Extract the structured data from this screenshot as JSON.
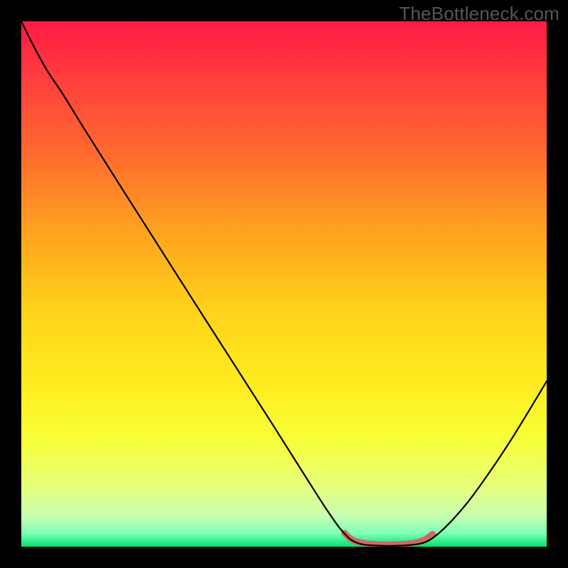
{
  "watermark": "TheBottleneck.com",
  "chart_data": {
    "type": "line",
    "title": "",
    "xlabel": "",
    "ylabel": "",
    "xlim": [
      0,
      100
    ],
    "ylim": [
      0,
      100
    ],
    "background_gradient": {
      "stops": [
        {
          "offset": 0.0,
          "color": "#ff1a44"
        },
        {
          "offset": 0.1,
          "color": "#ff3b3f"
        },
        {
          "offset": 0.25,
          "color": "#ff6a2e"
        },
        {
          "offset": 0.4,
          "color": "#ffa21f"
        },
        {
          "offset": 0.55,
          "color": "#ffd21a"
        },
        {
          "offset": 0.7,
          "color": "#ffee20"
        },
        {
          "offset": 0.8,
          "color": "#f7ff3a"
        },
        {
          "offset": 0.88,
          "color": "#e8ff77"
        },
        {
          "offset": 0.94,
          "color": "#c9ffb0"
        },
        {
          "offset": 0.975,
          "color": "#7dffb8"
        },
        {
          "offset": 1.0,
          "color": "#00e06a"
        }
      ]
    },
    "series": [
      {
        "name": "bottleneck-curve",
        "stroke": "#000000",
        "stroke_width": 2.2,
        "points": [
          {
            "x": 0.0,
            "y": 100.0
          },
          {
            "x": 2.5,
            "y": 95.0
          },
          {
            "x": 5.0,
            "y": 90.5
          },
          {
            "x": 8.0,
            "y": 86.0
          },
          {
            "x": 12.0,
            "y": 79.5
          },
          {
            "x": 18.0,
            "y": 70.0
          },
          {
            "x": 25.0,
            "y": 59.0
          },
          {
            "x": 32.0,
            "y": 48.0
          },
          {
            "x": 40.0,
            "y": 35.5
          },
          {
            "x": 48.0,
            "y": 23.0
          },
          {
            "x": 54.0,
            "y": 13.5
          },
          {
            "x": 58.5,
            "y": 6.5
          },
          {
            "x": 61.5,
            "y": 2.5
          },
          {
            "x": 64.0,
            "y": 0.7
          },
          {
            "x": 68.0,
            "y": 0.2
          },
          {
            "x": 72.0,
            "y": 0.2
          },
          {
            "x": 76.0,
            "y": 0.6
          },
          {
            "x": 78.5,
            "y": 1.8
          },
          {
            "x": 81.5,
            "y": 4.5
          },
          {
            "x": 85.0,
            "y": 8.5
          },
          {
            "x": 89.0,
            "y": 14.0
          },
          {
            "x": 93.0,
            "y": 20.0
          },
          {
            "x": 97.0,
            "y": 26.5
          },
          {
            "x": 100.0,
            "y": 31.5
          }
        ]
      },
      {
        "name": "optimal-band",
        "stroke": "#cc6a66",
        "stroke_width": 9,
        "points": [
          {
            "x": 61.5,
            "y": 2.6
          },
          {
            "x": 63.0,
            "y": 1.3
          },
          {
            "x": 65.0,
            "y": 0.7
          },
          {
            "x": 68.0,
            "y": 0.4
          },
          {
            "x": 71.0,
            "y": 0.4
          },
          {
            "x": 74.0,
            "y": 0.6
          },
          {
            "x": 76.5,
            "y": 1.2
          },
          {
            "x": 78.3,
            "y": 2.4
          }
        ]
      }
    ]
  }
}
